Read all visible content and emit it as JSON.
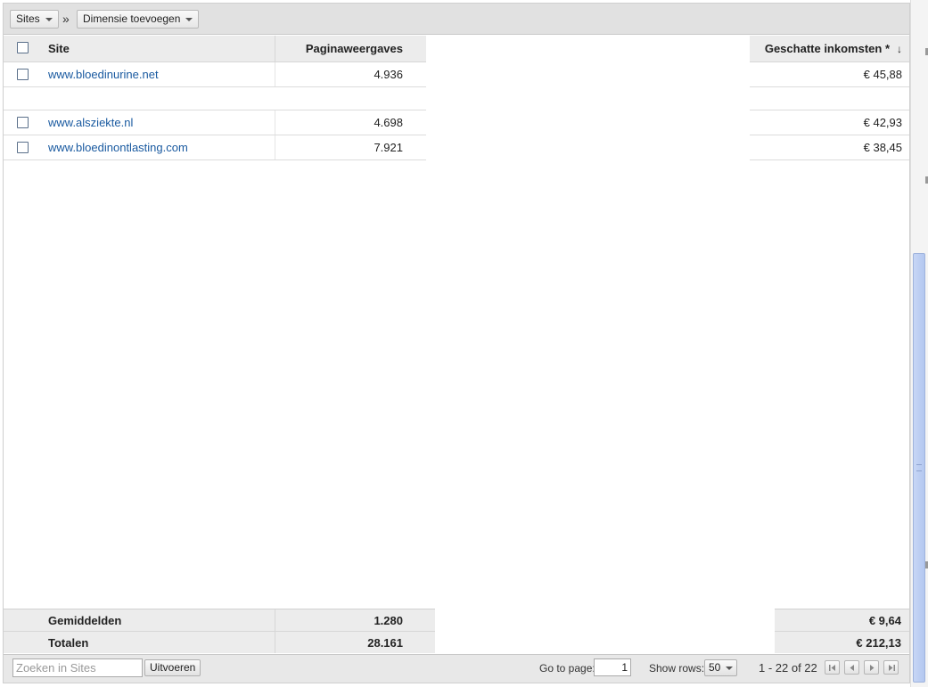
{
  "toolbar": {
    "sites_dropdown": "Sites",
    "separator": "»",
    "dimension_dropdown": "Dimensie toevoegen"
  },
  "table": {
    "columns": {
      "site": "Site",
      "pageviews": "Paginaweergaves",
      "earnings": "Geschatte inkomsten *",
      "sort_indicator": "↓"
    },
    "rows": [
      {
        "site": "www.bloedinurine.net",
        "pageviews": "4.936",
        "earnings": "€ 45,88"
      },
      {
        "site": "www.alsziekte.nl",
        "pageviews": "4.698",
        "earnings": "€ 42,93"
      },
      {
        "site": "www.bloedinontlasting.com",
        "pageviews": "7.921",
        "earnings": "€ 38,45"
      }
    ],
    "averages": {
      "label": "Gemiddelden",
      "pageviews": "1.280",
      "earnings": "€ 9,64"
    },
    "totals": {
      "label": "Totalen",
      "pageviews": "28.161",
      "earnings": "€ 212,13"
    }
  },
  "bottombar": {
    "search_placeholder": "Zoeken in Sites",
    "search_button": "Uitvoeren",
    "go_to_page_label": "Go to page:",
    "page_value": "1",
    "show_rows_label": "Show rows:",
    "rows_value": "50",
    "range_text": "1 - 22 of 22"
  }
}
